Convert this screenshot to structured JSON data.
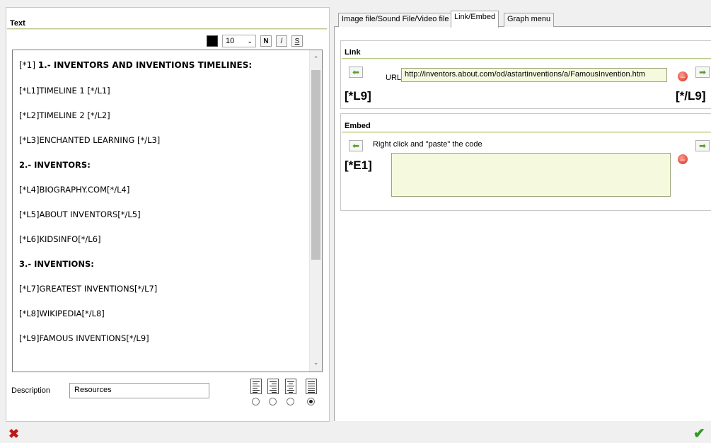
{
  "text_panel": {
    "title": "Text",
    "toolbar": {
      "font_size": "10",
      "bold": "N",
      "italic": "/",
      "underline": "S"
    },
    "lines": [
      "[*1] ",
      "1.- INVENTORS AND INVENTIONS TIMELINES:",
      "[*L1]TIMELINE 1 [*/L1]",
      "[*L2]TIMELINE 2 [*/L2]",
      "[*L3]ENCHANTED LEARNING [*/L3]",
      "2.- INVENTORS:",
      "[*L4]BIOGRAPHY.COM[*/L4]",
      "[*L5]ABOUT INVENTORS[*/L5]",
      "[*L6]KIDSINFO[*/L6]",
      "3.- INVENTIONS:",
      "[*L7]GREATEST INVENTIONS[*/L7]",
      "[*L8]WIKIPEDIA[*/L8]",
      "[*L9]FAMOUS INVENTIONS[*/L9]"
    ],
    "description_label": "Description",
    "description_value": "Resources",
    "alignment_selected": "justify"
  },
  "tabs": [
    {
      "label": "Image file/Sound File/Video file"
    },
    {
      "label": "Link/Embed"
    },
    {
      "label": "Graph menu"
    }
  ],
  "link_group": {
    "title": "Link",
    "url_label": "URL",
    "url_value": "http://inventors.about.com/od/astartinventions/a/FamousInvention.htm",
    "open_tag": "[*L9]",
    "close_tag": "[*/L9]"
  },
  "embed_group": {
    "title": "Embed",
    "hint": "Right click and \"paste\" the code",
    "tag": "[*E1]",
    "code_value": ""
  },
  "icons": {
    "arrow_left": "arrow-left-icon",
    "arrow_right": "arrow-right-icon",
    "delete": "delete-icon",
    "cancel": "cancel-x-icon",
    "confirm": "check-icon"
  }
}
